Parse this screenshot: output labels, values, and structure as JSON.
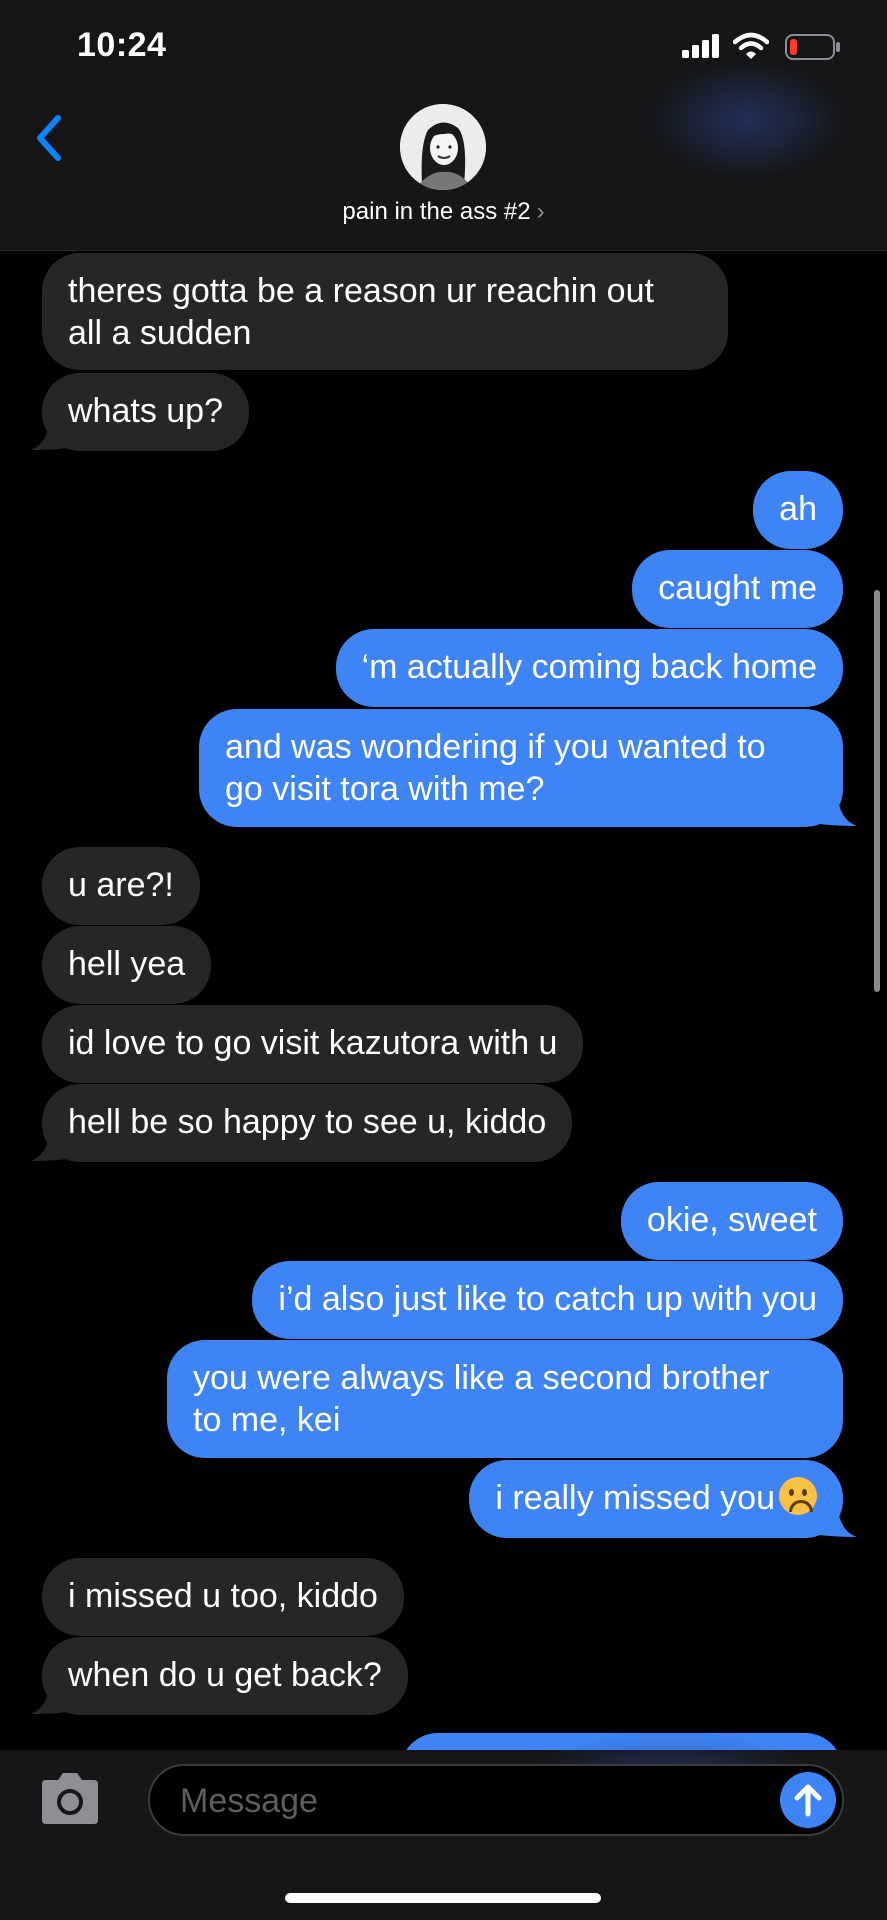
{
  "status_bar": {
    "time": "10:24"
  },
  "header": {
    "contact_name": "pain in the ass #2",
    "chevron": "›",
    "back_icon": "chevron-left-icon"
  },
  "messages": [
    {
      "from": "them",
      "lines": [
        "theres gotta be a reason ur reachin out",
        "all a sudden"
      ]
    },
    {
      "from": "them",
      "lines": [
        "whats up?"
      ]
    },
    {
      "from": "me",
      "lines": [
        "ah"
      ]
    },
    {
      "from": "me",
      "lines": [
        "caught me"
      ]
    },
    {
      "from": "me",
      "lines": [
        "‘m actually coming back home"
      ]
    },
    {
      "from": "me",
      "lines": [
        "and was wondering if you wanted to",
        "go visit tora with me?"
      ]
    },
    {
      "from": "them",
      "lines": [
        "u are?!"
      ]
    },
    {
      "from": "them",
      "lines": [
        "hell yea"
      ]
    },
    {
      "from": "them",
      "lines": [
        "id love to go visit kazutora with u"
      ]
    },
    {
      "from": "them",
      "lines": [
        "hell be so happy to see u, kiddo"
      ]
    },
    {
      "from": "me",
      "lines": [
        "okie, sweet"
      ]
    },
    {
      "from": "me",
      "lines": [
        "i’d also just like to catch up with you"
      ]
    },
    {
      "from": "me",
      "lines": [
        "you were always like a second brother",
        "to me, kei"
      ]
    },
    {
      "from": "me",
      "lines": [
        "i really missed you"
      ],
      "emoji": "frowning-face-emoji"
    },
    {
      "from": "them",
      "lines": [
        "i missed u too, kiddo"
      ]
    },
    {
      "from": "them",
      "lines": [
        "when do u get back?"
      ]
    }
  ],
  "composer": {
    "placeholder": "Message",
    "camera_icon": "camera-icon",
    "send_icon": "arrow-up-icon"
  },
  "colors": {
    "outgoing": "#3f84f4",
    "incoming": "#262629",
    "background": "#000000",
    "header": "#161618"
  }
}
